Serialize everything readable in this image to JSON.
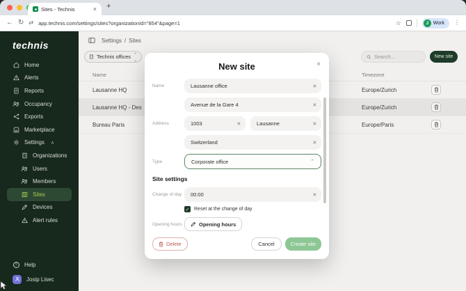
{
  "browser": {
    "tab_title": "Sites - Technis",
    "new_tab": "+",
    "url": "app.technis.com/settings/sites?organizationId=\"854\"&page=1",
    "profile": {
      "initial": "J",
      "label": "Work"
    }
  },
  "sidebar": {
    "logo": "technis",
    "items": [
      {
        "label": "Home"
      },
      {
        "label": "Alerts"
      },
      {
        "label": "Reports"
      },
      {
        "label": "Occupancy"
      },
      {
        "label": "Exports"
      },
      {
        "label": "Marketplace"
      },
      {
        "label": "Settings"
      }
    ],
    "settings_children": [
      {
        "label": "Organizations"
      },
      {
        "label": "Users"
      },
      {
        "label": "Members"
      },
      {
        "label": "Sites"
      },
      {
        "label": "Devices"
      },
      {
        "label": "Alert rules"
      }
    ],
    "help": "Help",
    "user": "Josip Lisec"
  },
  "header": {
    "breadcrumb": {
      "settings": "Settings",
      "separator": "/",
      "sites": "Sites"
    },
    "org_chip": "Technis offices",
    "search_placeholder": "Search...",
    "new_site_button": "New site"
  },
  "table": {
    "col_name": "Name",
    "col_timezone": "Timezone",
    "rows": [
      {
        "name": "Lausanne HQ",
        "timezone": "Europe/Zurich"
      },
      {
        "name": "Lausanne HQ - Des",
        "timezone": "Europe/Zurich"
      },
      {
        "name": "Bureau Paris",
        "timezone": "Europe/Paris"
      }
    ]
  },
  "modal": {
    "title": "New site",
    "name_label": "Name",
    "name_value": "Lausanne office",
    "address_label": "Address",
    "street_value": "Avenue de la Gare 4",
    "zip_value": "1003",
    "city_value": "Lausanne",
    "country_value": "Switzerland",
    "type_label": "Type",
    "type_value": "Corporate office",
    "section_title": "Site settings",
    "change_of_day_label": "Change of day",
    "change_of_day_value": "00:00",
    "reset_label": "Reset at the change of day",
    "opening_hours_label": "Opening hours",
    "opening_hours_button": "Opening hours",
    "delete_button": "Delete",
    "cancel_button": "Cancel",
    "create_button": "Create site"
  },
  "colors": {
    "sidebar_bg": "#17281d",
    "active_item_bg": "#2d4833",
    "active_item_text": "#a6d14f",
    "primary_button_bg": "#1e3b2a",
    "create_button_bg": "#8cc794",
    "delete_text": "#bb5a4e",
    "type_focus_border": "#5c8866",
    "profile_avatar": "#1d9a57"
  }
}
